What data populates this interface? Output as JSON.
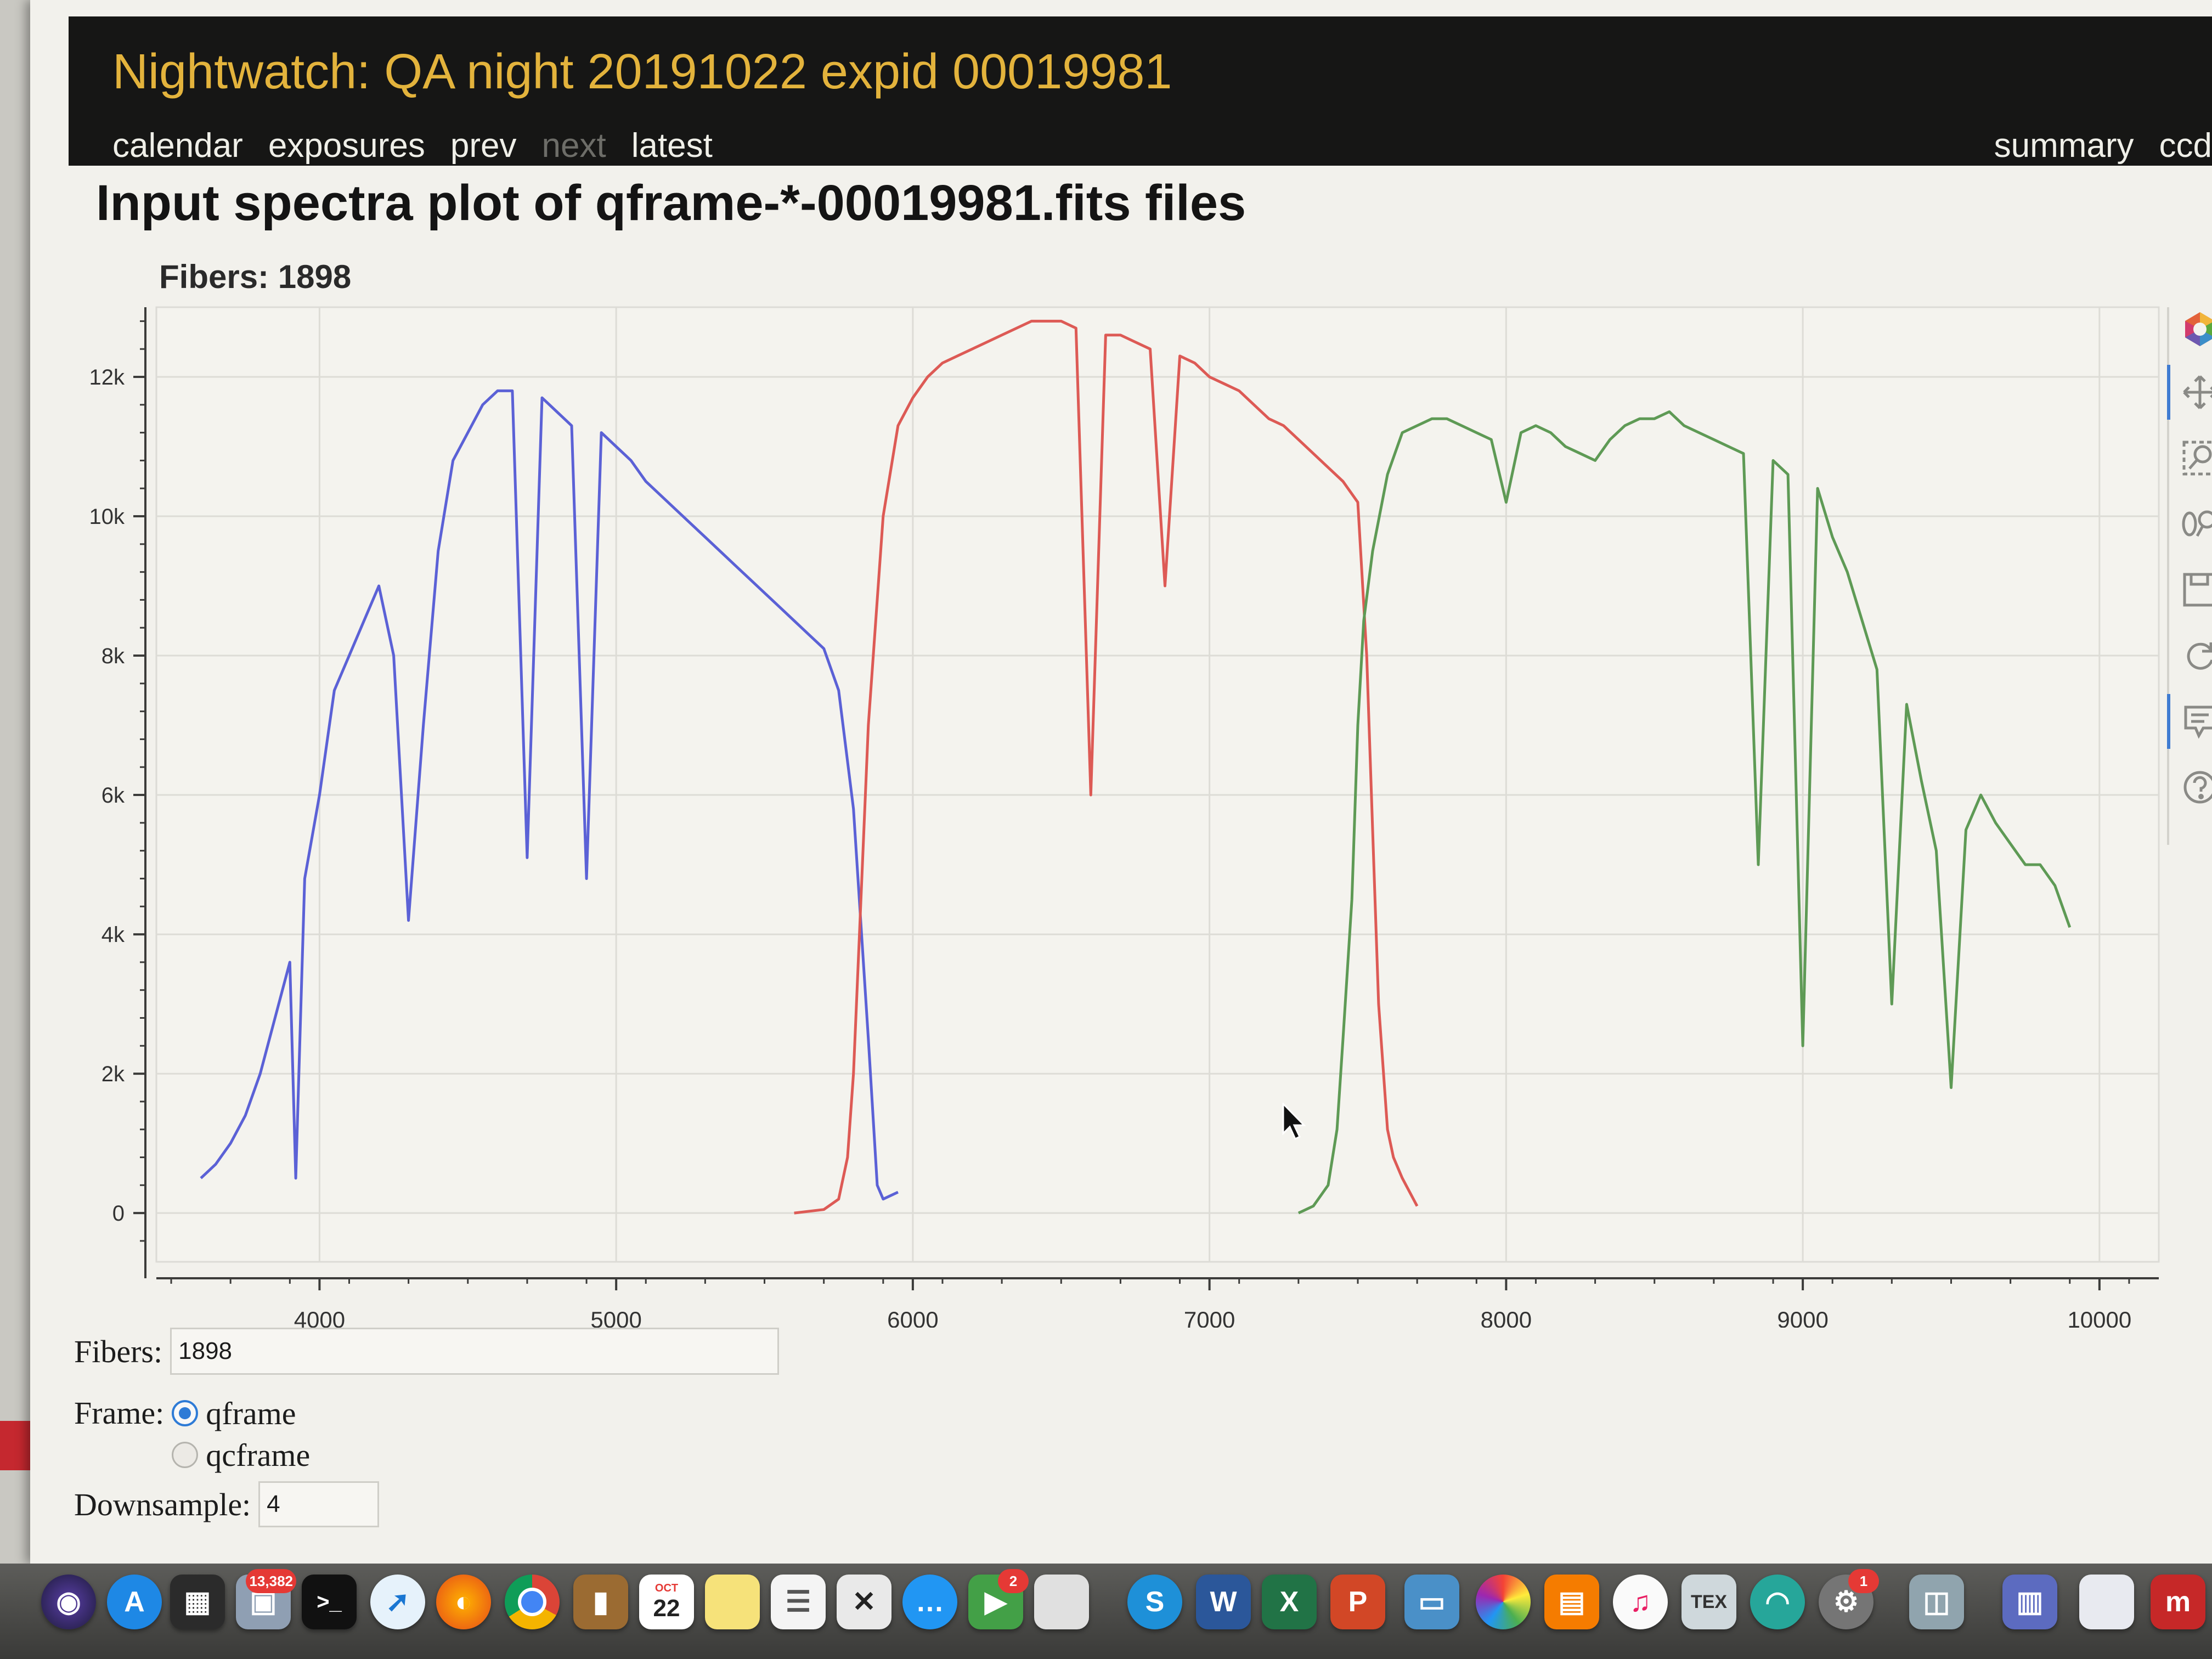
{
  "header": {
    "title": "Nightwatch: QA night 20191022 expid 00019981",
    "nav_left": [
      "calendar",
      "exposures",
      "prev",
      "next",
      "latest"
    ],
    "nav_right": [
      "summary",
      "ccd"
    ]
  },
  "page_title": "Input spectra plot of qframe-*-00019981.fits files",
  "plot_label": "Fibers: 1898",
  "chart_data": {
    "type": "line",
    "xlim": [
      3450,
      10200
    ],
    "ylim": [
      -700,
      13000
    ],
    "x_ticks": [
      4000,
      5000,
      6000,
      7000,
      8000,
      9000,
      10000
    ],
    "x_tick_labels": [
      "4000",
      "5000",
      "6000",
      "7000",
      "8000",
      "9000",
      "10000"
    ],
    "y_ticks": [
      0,
      2000,
      4000,
      6000,
      8000,
      10000,
      12000
    ],
    "y_tick_labels": [
      "0",
      "2k",
      "4k",
      "6k",
      "8k",
      "10k",
      "12k"
    ],
    "grid": true,
    "series": [
      {
        "color": "#5b61d6",
        "x": [
          3600,
          3650,
          3700,
          3750,
          3800,
          3850,
          3900,
          3920,
          3950,
          4000,
          4050,
          4100,
          4150,
          4200,
          4250,
          4300,
          4350,
          4400,
          4450,
          4500,
          4550,
          4600,
          4650,
          4700,
          4750,
          4800,
          4850,
          4900,
          4950,
          5000,
          5050,
          5100,
          5150,
          5200,
          5250,
          5300,
          5350,
          5400,
          5450,
          5500,
          5550,
          5600,
          5650,
          5700,
          5750,
          5800,
          5850,
          5880,
          5900,
          5950
        ],
        "y": [
          500,
          700,
          1000,
          1400,
          2000,
          2800,
          3600,
          500,
          4800,
          6000,
          7500,
          8000,
          8500,
          9000,
          8000,
          4200,
          7000,
          9500,
          10800,
          11200,
          11600,
          11800,
          11800,
          5100,
          11700,
          11500,
          11300,
          4800,
          11200,
          11000,
          10800,
          10500,
          10300,
          10100,
          9900,
          9700,
          9500,
          9300,
          9100,
          8900,
          8700,
          8500,
          8300,
          8100,
          7500,
          5800,
          2500,
          400,
          200,
          300
        ]
      },
      {
        "color": "#dd5a55",
        "x": [
          5600,
          5700,
          5750,
          5780,
          5800,
          5820,
          5850,
          5900,
          5950,
          6000,
          6050,
          6100,
          6150,
          6200,
          6250,
          6300,
          6350,
          6400,
          6450,
          6500,
          6550,
          6600,
          6650,
          6700,
          6750,
          6800,
          6850,
          6900,
          6950,
          7000,
          7050,
          7100,
          7150,
          7200,
          7250,
          7300,
          7350,
          7400,
          7450,
          7500,
          7530,
          7550,
          7570,
          7600,
          7620,
          7650,
          7700
        ],
        "y": [
          0,
          50,
          200,
          800,
          2000,
          4000,
          7000,
          10000,
          11300,
          11700,
          12000,
          12200,
          12300,
          12400,
          12500,
          12600,
          12700,
          12800,
          12800,
          12800,
          12700,
          6000,
          12600,
          12600,
          12500,
          12400,
          9000,
          12300,
          12200,
          12000,
          11900,
          11800,
          11600,
          11400,
          11300,
          11100,
          10900,
          10700,
          10500,
          10200,
          8000,
          5500,
          3000,
          1200,
          800,
          500,
          100
        ]
      },
      {
        "color": "#5e9a55",
        "x": [
          7300,
          7350,
          7400,
          7430,
          7450,
          7480,
          7500,
          7520,
          7550,
          7600,
          7650,
          7700,
          7750,
          7800,
          7850,
          7900,
          7950,
          8000,
          8050,
          8100,
          8150,
          8200,
          8250,
          8300,
          8350,
          8400,
          8450,
          8500,
          8550,
          8600,
          8650,
          8700,
          8750,
          8800,
          8850,
          8900,
          8950,
          9000,
          9050,
          9100,
          9150,
          9200,
          9250,
          9300,
          9350,
          9400,
          9450,
          9500,
          9550,
          9600,
          9650,
          9700,
          9750,
          9800,
          9850,
          9900
        ],
        "y": [
          0,
          100,
          400,
          1200,
          2500,
          4500,
          7000,
          8500,
          9500,
          10600,
          11200,
          11300,
          11400,
          11400,
          11300,
          11200,
          11100,
          10200,
          11200,
          11300,
          11200,
          11000,
          10900,
          10800,
          11100,
          11300,
          11400,
          11400,
          11500,
          11300,
          11200,
          11100,
          11000,
          10900,
          5000,
          10800,
          10600,
          2400,
          10400,
          9700,
          9200,
          8500,
          7800,
          3000,
          7300,
          6200,
          5200,
          1800,
          5500,
          6000,
          5600,
          5300,
          5000,
          5000,
          4700,
          4100
        ]
      }
    ]
  },
  "widgets": {
    "fibers_label": "Fibers:",
    "fibers_value": "1898",
    "frame_label": "Frame:",
    "frame_options": [
      "qframe",
      "qcframe"
    ],
    "frame_selected": "qframe",
    "downsample_label": "Downsample:",
    "downsample_value": "4"
  },
  "dock": {
    "calendar_month": "OCT",
    "calendar_day": "22",
    "photos_badge": "13,382",
    "facetime_badge": "2",
    "prefs_badge": "1",
    "word_letter": "W",
    "excel_letter": "X",
    "ppt_letter": "P",
    "skype_letter": "S",
    "tex_label": "TEX"
  }
}
